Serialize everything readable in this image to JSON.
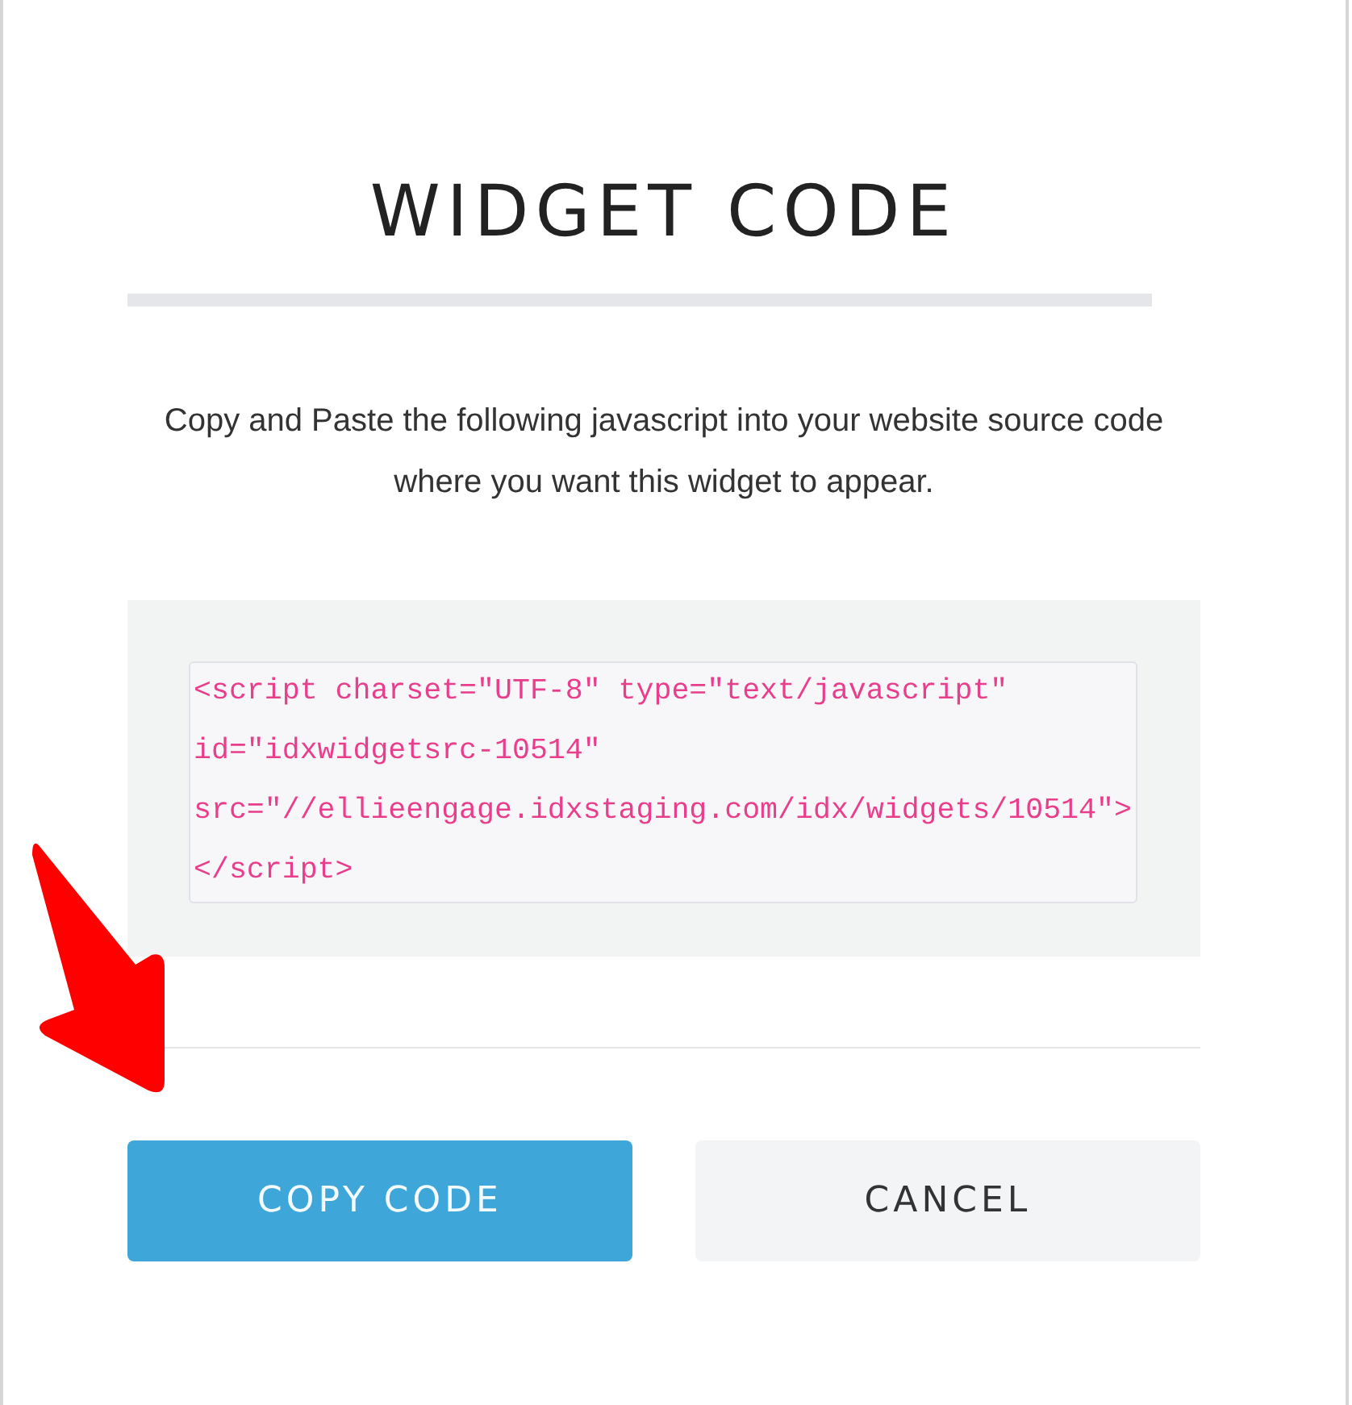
{
  "dialog": {
    "title": "WIDGET CODE",
    "description": "Copy and Paste the following javascript into your website source code where you want this widget to appear.",
    "code": "<script charset=\"UTF-8\" type=\"text/javascript\" id=\"idxwidgetsrc-10514\" src=\"//ellieengage.idxstaging.com/idx/widgets/10514\"></script>",
    "buttons": [
      {
        "label": "COPY CODE",
        "kind": "primary"
      },
      {
        "label": "CANCEL",
        "kind": "secondary"
      }
    ]
  }
}
